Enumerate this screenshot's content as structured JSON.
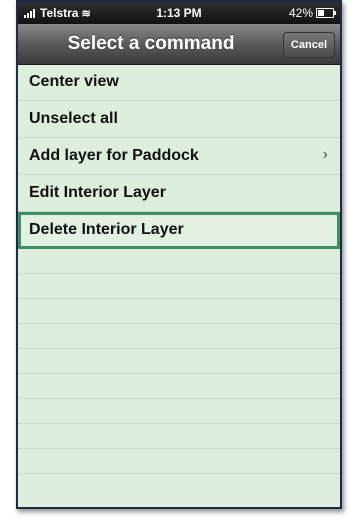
{
  "status": {
    "carrier": "Telstra",
    "time": "1:13 PM",
    "battery": "42%",
    "battery_level": 0.42
  },
  "nav": {
    "title": "Select a command",
    "cancel": "Cancel"
  },
  "commands": [
    {
      "label": "Center view"
    },
    {
      "label": "Unselect all"
    },
    {
      "label": "Add layer for Paddock",
      "chevron": "›"
    },
    {
      "label": "Edit Interior Layer"
    },
    {
      "label": "Delete Interior Layer"
    }
  ]
}
